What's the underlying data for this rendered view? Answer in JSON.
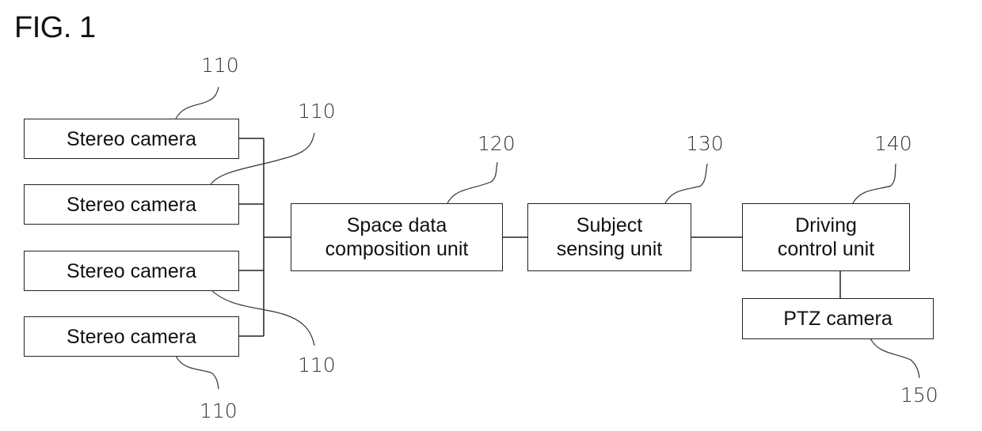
{
  "figure": {
    "title": "FIG. 1"
  },
  "blocks": {
    "stereo_camera_1": {
      "label": "Stereo camera",
      "ref": "110"
    },
    "stereo_camera_2": {
      "label": "Stereo camera",
      "ref": "110"
    },
    "stereo_camera_3": {
      "label": "Stereo camera",
      "ref": "110"
    },
    "stereo_camera_4": {
      "label": "Stereo camera",
      "ref": "110"
    },
    "space_data": {
      "line1": "Space data",
      "line2": "composition unit",
      "ref": "120"
    },
    "subject_sensing": {
      "line1": "Subject",
      "line2": "sensing unit",
      "ref": "130"
    },
    "driving_control": {
      "line1": "Driving",
      "line2": "control unit",
      "ref": "140"
    },
    "ptz_camera": {
      "label": "PTZ camera",
      "ref": "150"
    }
  },
  "connections": [
    [
      "stereo_camera_1",
      "space_data"
    ],
    [
      "stereo_camera_2",
      "space_data"
    ],
    [
      "stereo_camera_3",
      "space_data"
    ],
    [
      "stereo_camera_4",
      "space_data"
    ],
    [
      "space_data",
      "subject_sensing"
    ],
    [
      "subject_sensing",
      "driving_control"
    ],
    [
      "driving_control",
      "ptz_camera"
    ]
  ]
}
